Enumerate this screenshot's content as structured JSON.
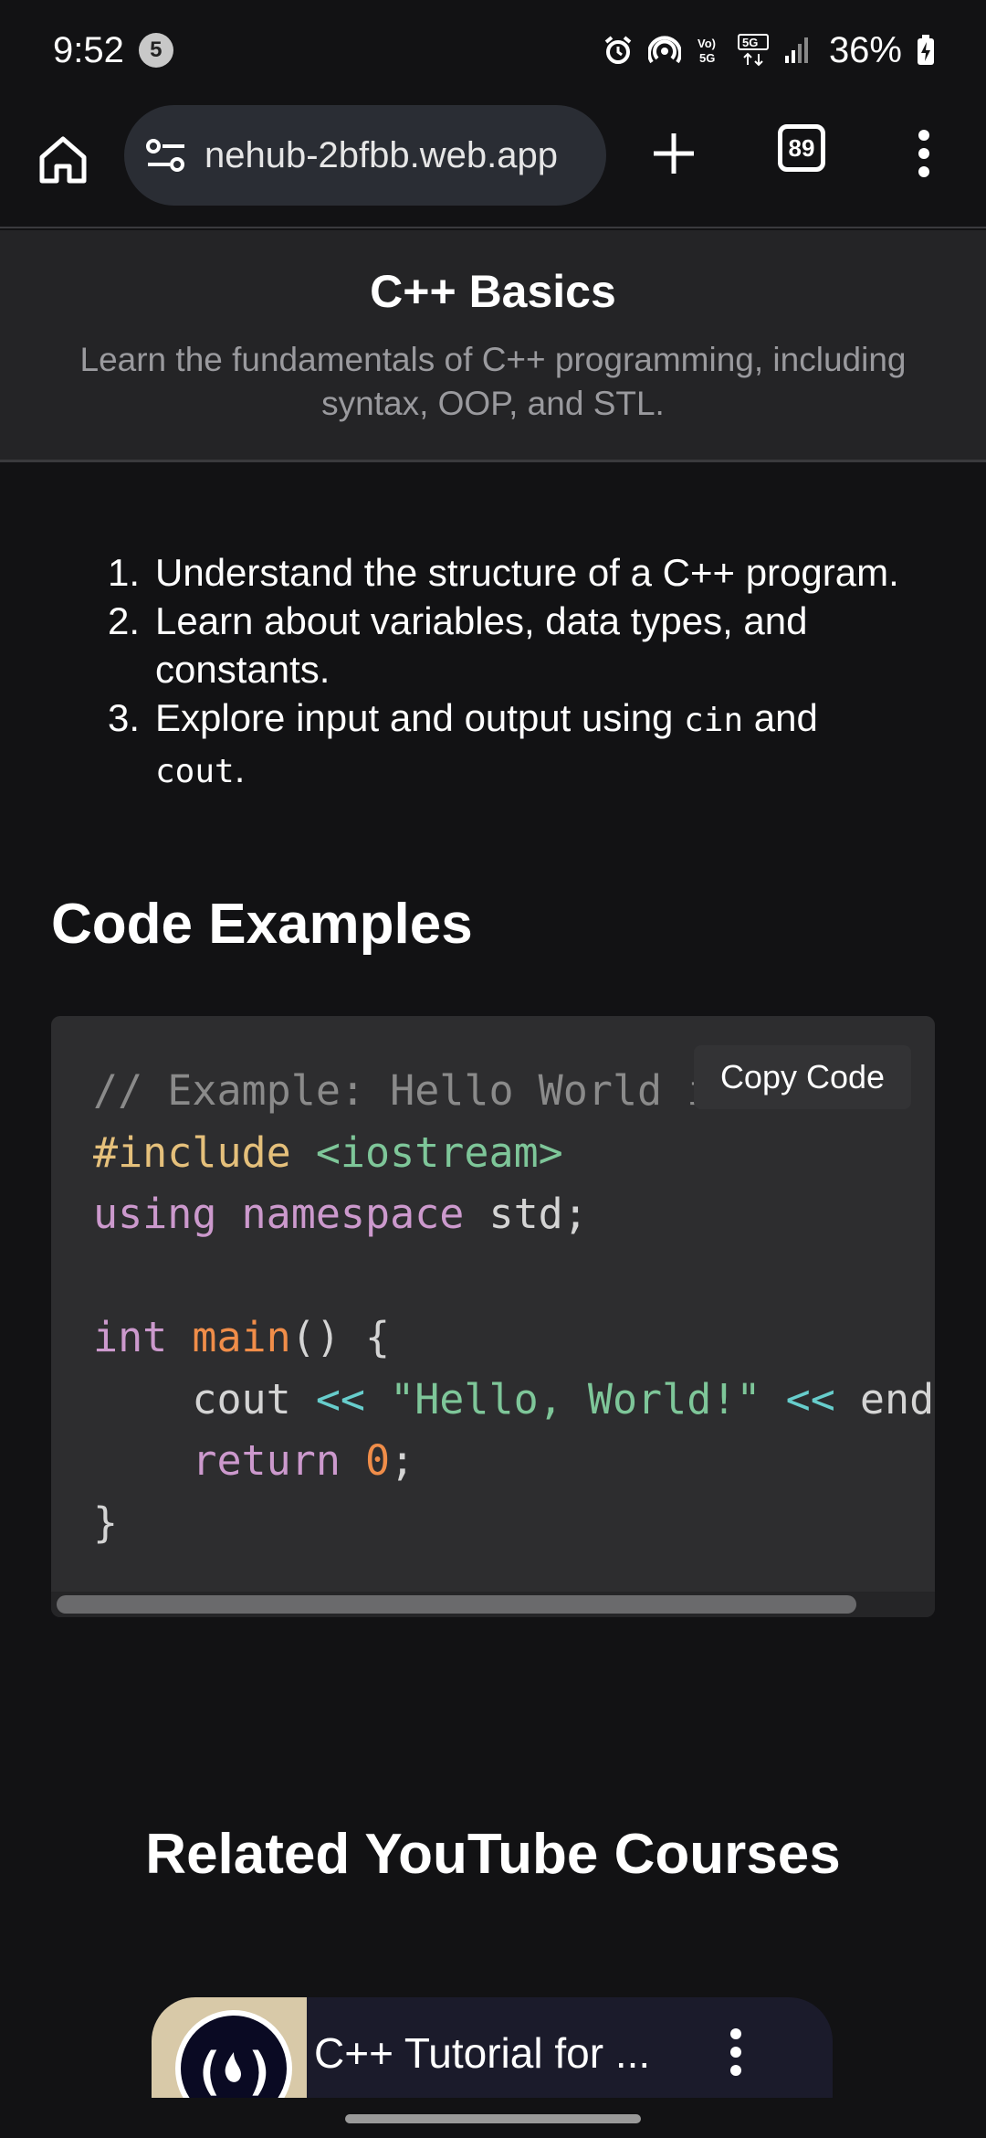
{
  "status_bar": {
    "time": "9:52",
    "notification_count": "5",
    "network_label": "5G",
    "battery": "36%"
  },
  "browser": {
    "url": "nehub-2bfbb.web.app",
    "tab_count": "89"
  },
  "header": {
    "title": "C++ Basics",
    "subtitle": "Learn the fundamentals of C++ programming, including syntax, OOP, and STL."
  },
  "objectives": [
    {
      "num": "1.",
      "text": "Understand the structure of a C++ program."
    },
    {
      "num": "2.",
      "text": "Learn about variables, data types, and constants."
    },
    {
      "num": "3.",
      "pre": "Explore input and output using ",
      "code1": "cin",
      "mid": " and ",
      "code2": "cout",
      "post": "."
    }
  ],
  "code_section": {
    "heading": "Code Examples",
    "copy_label": "Copy Code",
    "lines": {
      "l1": "// Example: Hello World in C++",
      "l2_pre": "#include",
      "l2_incl": " <iostream>",
      "l3_kw": "using namespace",
      "l3_rest": " std;",
      "l5_kw": "int",
      "l5_fn": " main",
      "l5_rest": "() {",
      "l6_a": "    cout ",
      "l6_op1": "<<",
      "l6_str": " \"Hello, World!\"",
      "l6_op2": " <<",
      "l6_b": " endl;",
      "l7_kw": "    return",
      "l7_num": " 0",
      "l7_rest": ";",
      "l8": "}"
    }
  },
  "youtube": {
    "heading": "Related YouTube Courses",
    "card_title": "C++ Tutorial for ..."
  },
  "colors": {
    "background": "#121214",
    "header_bg": "#242426",
    "code_bg": "#2d2d2f",
    "url_pill": "#2a2d34"
  }
}
